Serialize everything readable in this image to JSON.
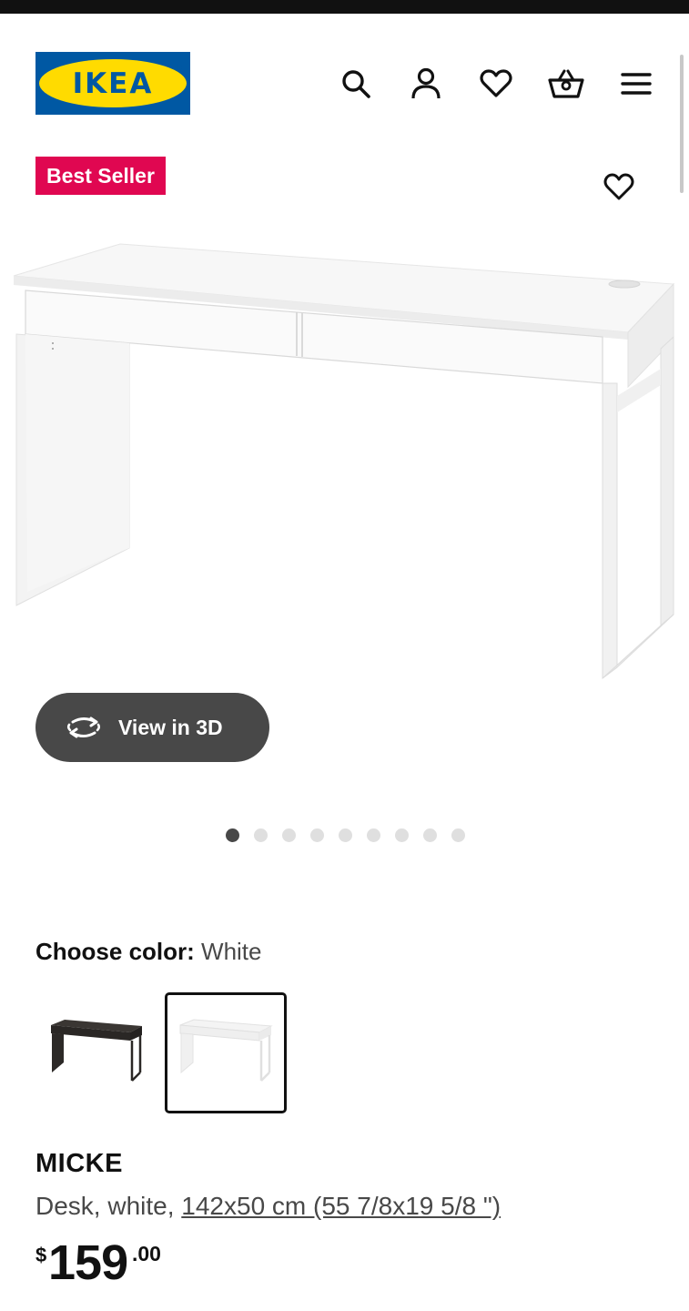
{
  "header": {
    "logo_text": "IKEA",
    "icons": [
      "search-icon",
      "account-icon",
      "heart-icon",
      "basket-icon",
      "menu-icon"
    ]
  },
  "badge": {
    "label": "Best Seller",
    "color": "#e00751"
  },
  "gallery": {
    "view3d_label": "View in 3D",
    "image_count": 9,
    "active_index": 0
  },
  "color_picker": {
    "label": "Choose color:",
    "selected": "White",
    "options": [
      "Black-brown",
      "White"
    ]
  },
  "product": {
    "name": "MICKE",
    "description": "Desk, white, ",
    "size": "142x50 cm (55 7/8x19 5/8 \")",
    "price_currency": "$",
    "price_integer": "159",
    "price_decimal": ".00"
  },
  "colors": {
    "brand_blue": "#0058a3",
    "brand_yellow": "#ffdb00",
    "button_dark": "#484848"
  }
}
